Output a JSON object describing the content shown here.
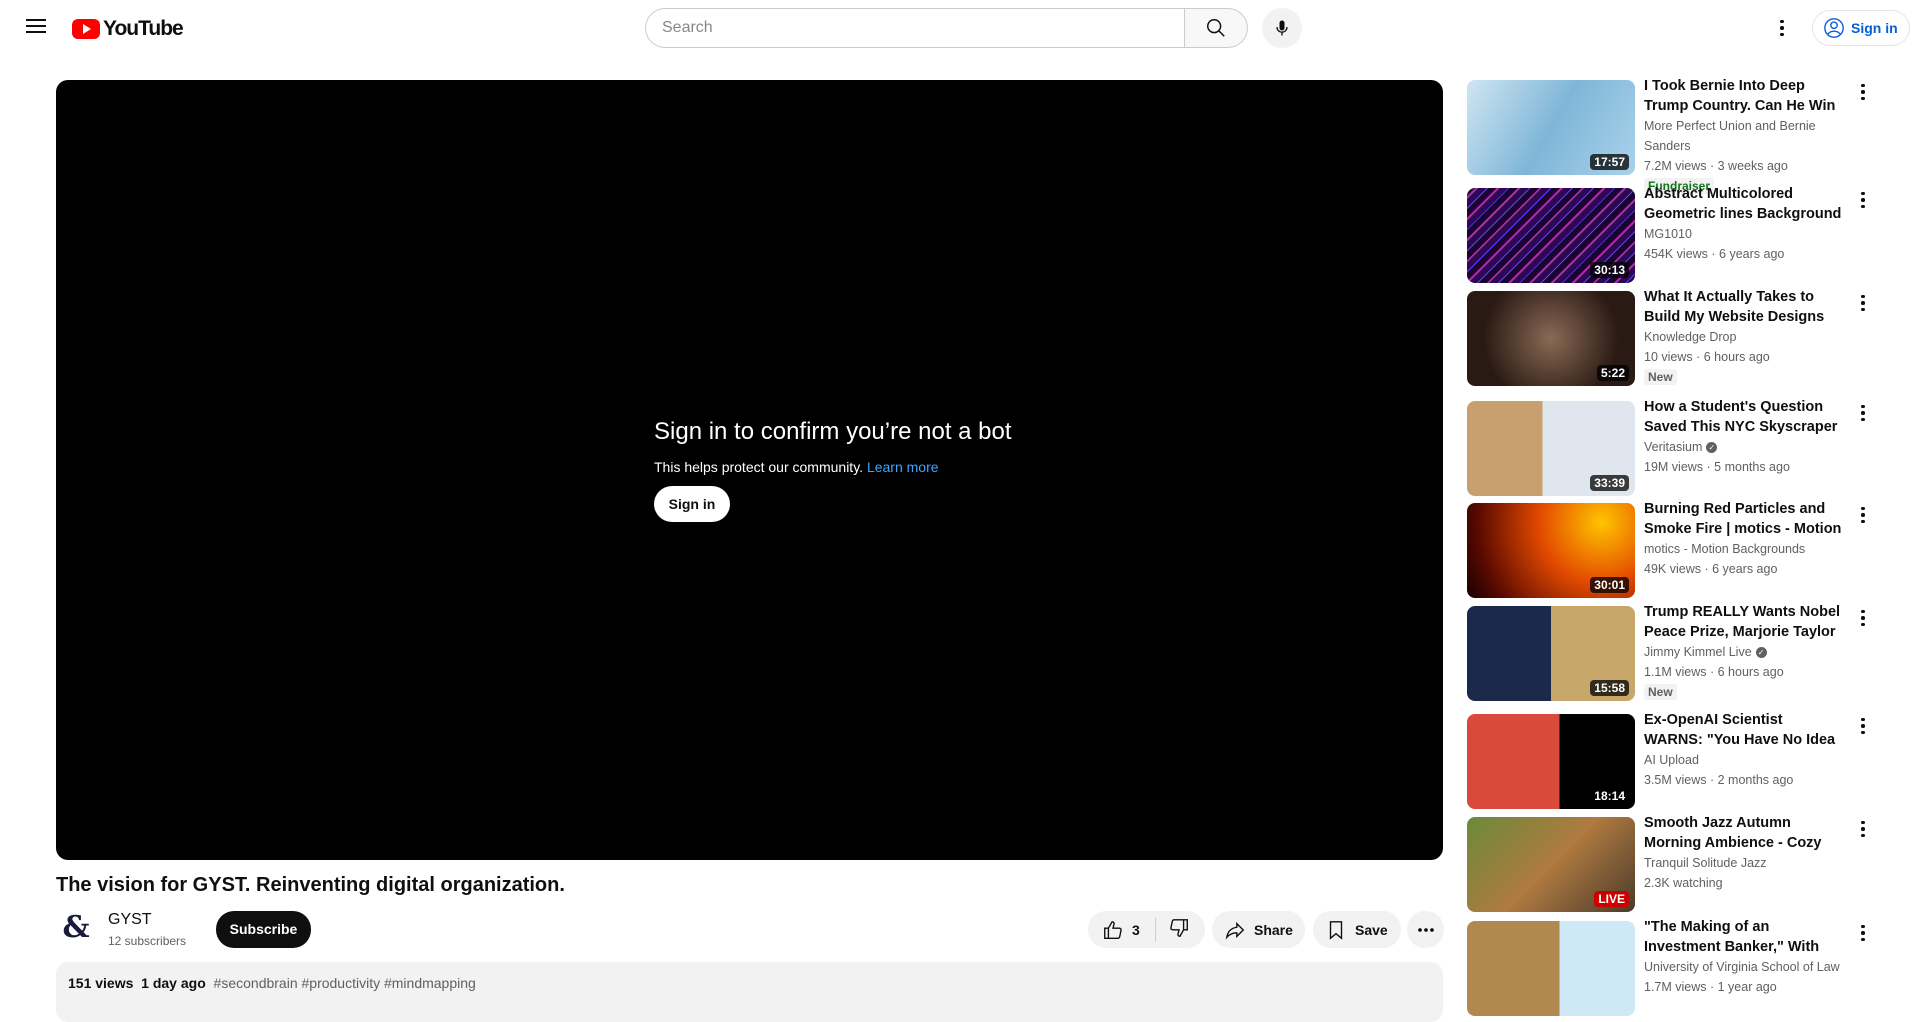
{
  "header": {
    "logo_text": "YouTube",
    "search_placeholder": "Search",
    "sign_in": "Sign in"
  },
  "player": {
    "title": "Sign in to confirm you’re not a bot",
    "subtitle": "This helps protect our community.",
    "learn_more": "Learn more",
    "sign_in": "Sign in"
  },
  "video": {
    "title": "The vision for GYST. Reinventing digital organization.",
    "channel": "GYST",
    "avatar_glyph": "&",
    "subscribers": "12 subscribers",
    "subscribe": "Subscribe",
    "likes": "3",
    "share": "Share",
    "save": "Save",
    "views": "151 views",
    "date": "1 day ago",
    "tags": "#secondbrain #productivity #mindmapping"
  },
  "related": [
    {
      "title": "I Took Bernie Into Deep Trump Country. Can He Win Them ...",
      "channel": "More Perfect Union and Bernie Sanders",
      "stats": "7.2M views · 3 weeks ago",
      "duration": "17:57",
      "badge": "Fundraiser"
    },
    {
      "title": "Abstract Multicolored Geometric lines Background ...",
      "channel": "MG1010",
      "stats": "454K views · 6 years ago",
      "duration": "30:13"
    },
    {
      "title": "What It Actually Takes to Build My Website Designs",
      "channel": "Knowledge Drop",
      "stats": "10 views · 6 hours ago",
      "duration": "5:22",
      "badge": "New"
    },
    {
      "title": "How a Student's Question Saved This NYC Skyscraper",
      "channel": "Veritasium",
      "stats": "19M views · 5 months ago",
      "duration": "33:39"
    },
    {
      "title": "Burning Red Particles and Smoke Fire | motics - Motion ...",
      "channel": "motics - Motion Backgrounds",
      "stats": "49K views · 6 years ago",
      "duration": "30:01"
    },
    {
      "title": "Trump REALLY Wants Nobel Peace Prize, Marjorie Taylor ...",
      "channel": "Jimmy Kimmel Live",
      "stats": "1.1M views · 6 hours ago",
      "duration": "15:58",
      "badge": "New"
    },
    {
      "title": "Ex-OpenAI Scientist WARNS: \"You Have No Idea What's ...",
      "channel": "AI Upload",
      "stats": "3.5M views · 2 months ago",
      "duration": "18:14"
    },
    {
      "title": "Smooth Jazz Autumn Morning Ambience - Cozy Cafe Music ...",
      "channel": "Tranquil Solitude Jazz",
      "stats": "2.3K watching",
      "duration": "LIVE"
    },
    {
      "title": "\"The Making of an Investment Banker,\" With Jim Donovan",
      "channel": "University of Virginia School of Law",
      "stats": "1.7M views · 1 year ago",
      "duration": ""
    }
  ]
}
